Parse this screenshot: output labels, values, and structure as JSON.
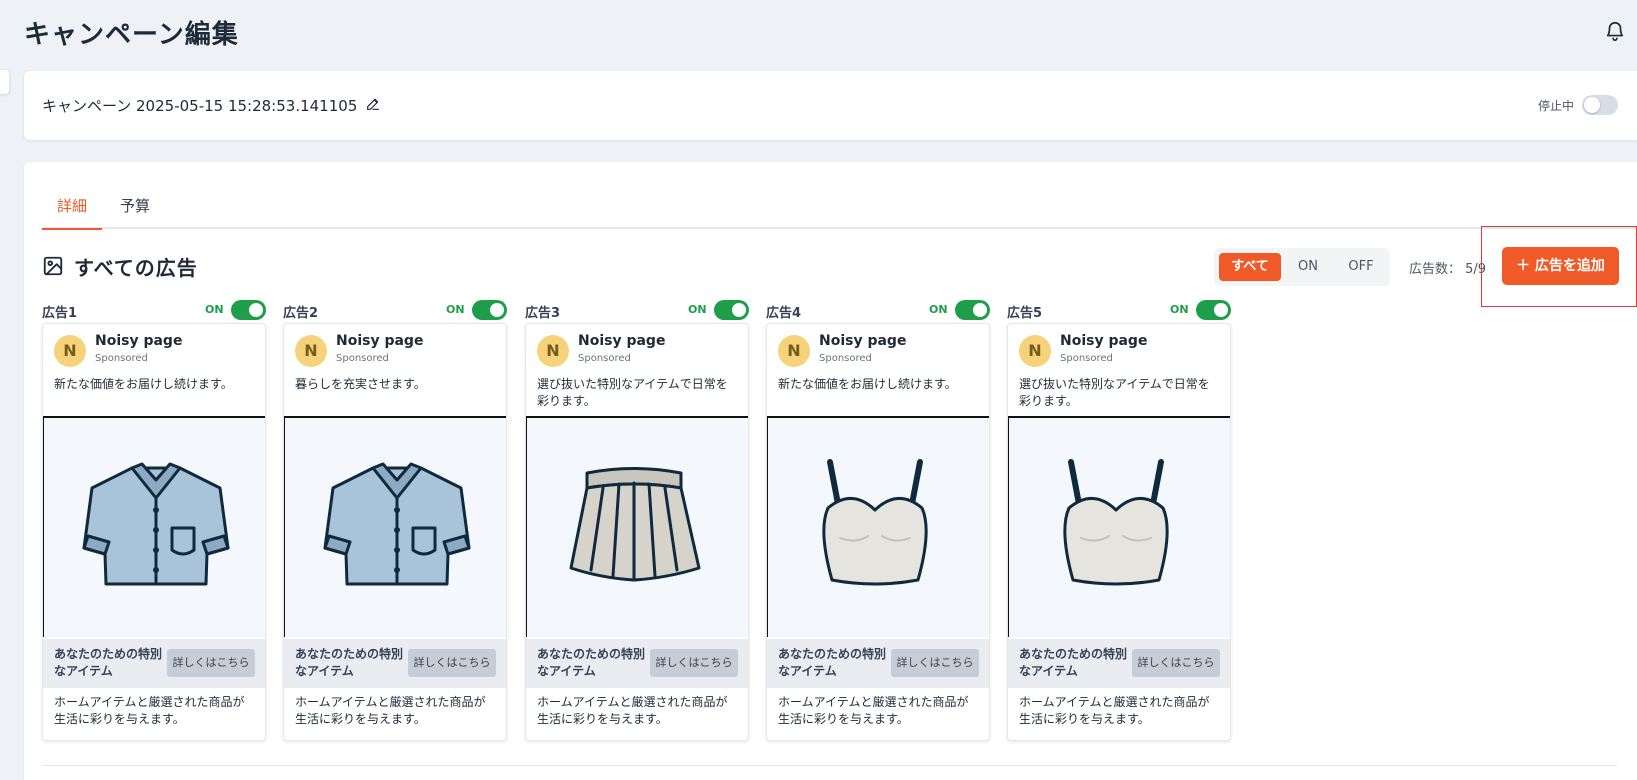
{
  "page": {
    "title": "キャンペーン編集"
  },
  "campaign": {
    "name": "キャンペーン 2025-05-15 15:28:53.141105",
    "status_label": "停止中"
  },
  "tabs": [
    {
      "label": "詳細",
      "active": true
    },
    {
      "label": "予算",
      "active": false
    }
  ],
  "section": {
    "title": "すべての広告",
    "filters": [
      "すべて",
      "ON",
      "OFF"
    ],
    "selected_filter": "すべて",
    "ad_count": "広告数： 5/9",
    "add_button": "＋  広告を追加"
  },
  "ads": [
    {
      "label": "広告1",
      "status": "ON",
      "page_name": "Noisy page",
      "avatar": "N",
      "sponsored": "Sponsored",
      "text": "新たな価値をお届けし続けます。",
      "image": "shirt-illustration",
      "headline": "あなたのための特別なアイテム",
      "cta": "詳しくはこちら",
      "description": "ホームアイテムと厳選された商品が生活に彩りを与えます。"
    },
    {
      "label": "広告2",
      "status": "ON",
      "page_name": "Noisy page",
      "avatar": "N",
      "sponsored": "Sponsored",
      "text": "暮らしを充実させます。",
      "image": "shirt-illustration",
      "headline": "あなたのための特別なアイテム",
      "cta": "詳しくはこちら",
      "description": "ホームアイテムと厳選された商品が生活に彩りを与えます。"
    },
    {
      "label": "広告3",
      "status": "ON",
      "page_name": "Noisy page",
      "avatar": "N",
      "sponsored": "Sponsored",
      "text": "選び抜いた特別なアイテムで日常を彩ります。",
      "image": "skirt-illustration",
      "headline": "あなたのための特別なアイテム",
      "cta": "詳しくはこちら",
      "description": "ホームアイテムと厳選された商品が生活に彩りを与えます。"
    },
    {
      "label": "広告4",
      "status": "ON",
      "page_name": "Noisy page",
      "avatar": "N",
      "sponsored": "Sponsored",
      "text": "新たな価値をお届けし続けます。",
      "image": "bustier-illustration",
      "headline": "あなたのための特別なアイテム",
      "cta": "詳しくはこちら",
      "description": "ホームアイテムと厳選された商品が生活に彩りを与えます。"
    },
    {
      "label": "広告5",
      "status": "ON",
      "page_name": "Noisy page",
      "avatar": "N",
      "sponsored": "Sponsored",
      "text": "選び抜いた特別なアイテムで日常を彩ります。",
      "image": "bustier-illustration",
      "headline": "あなたのための特別なアイテム",
      "cta": "詳しくはこちら",
      "description": "ホームアイテムと厳選された商品が生活に彩りを与えます。"
    }
  ],
  "colors": {
    "accent": "#f05a28",
    "on_green": "#1e9e4a"
  }
}
